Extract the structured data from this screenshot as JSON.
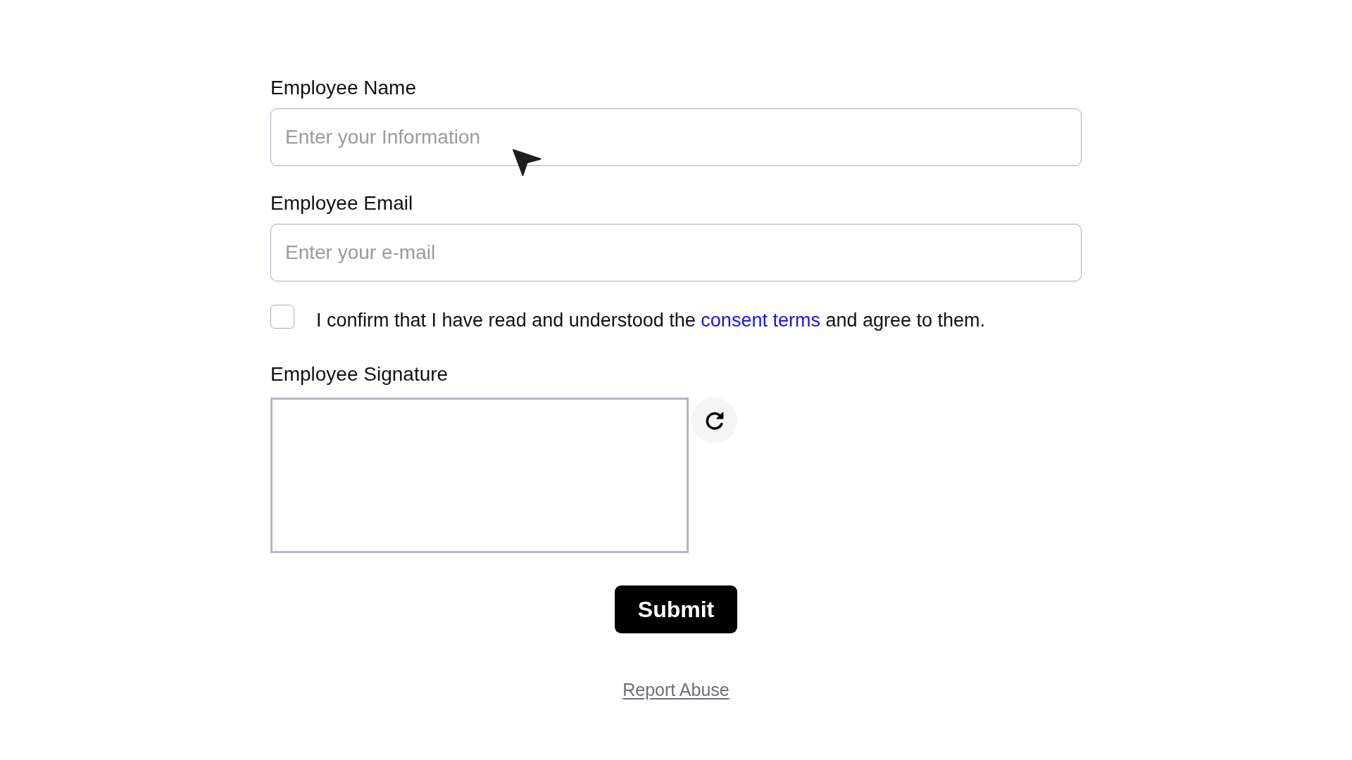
{
  "fields": [
    {
      "label": "Employee Name",
      "placeholder": "Enter your Information"
    },
    {
      "label": "Employee Email",
      "placeholder": "Enter your e-mail"
    }
  ],
  "consent": {
    "checked": false,
    "text_before": "I confirm that I have read and understood the ",
    "link": "consent terms",
    "text_after": " and agree to them."
  },
  "signature": {
    "label": "Employee Signature"
  },
  "submit_button": "Submit",
  "footer_link": "Report Abuse"
}
